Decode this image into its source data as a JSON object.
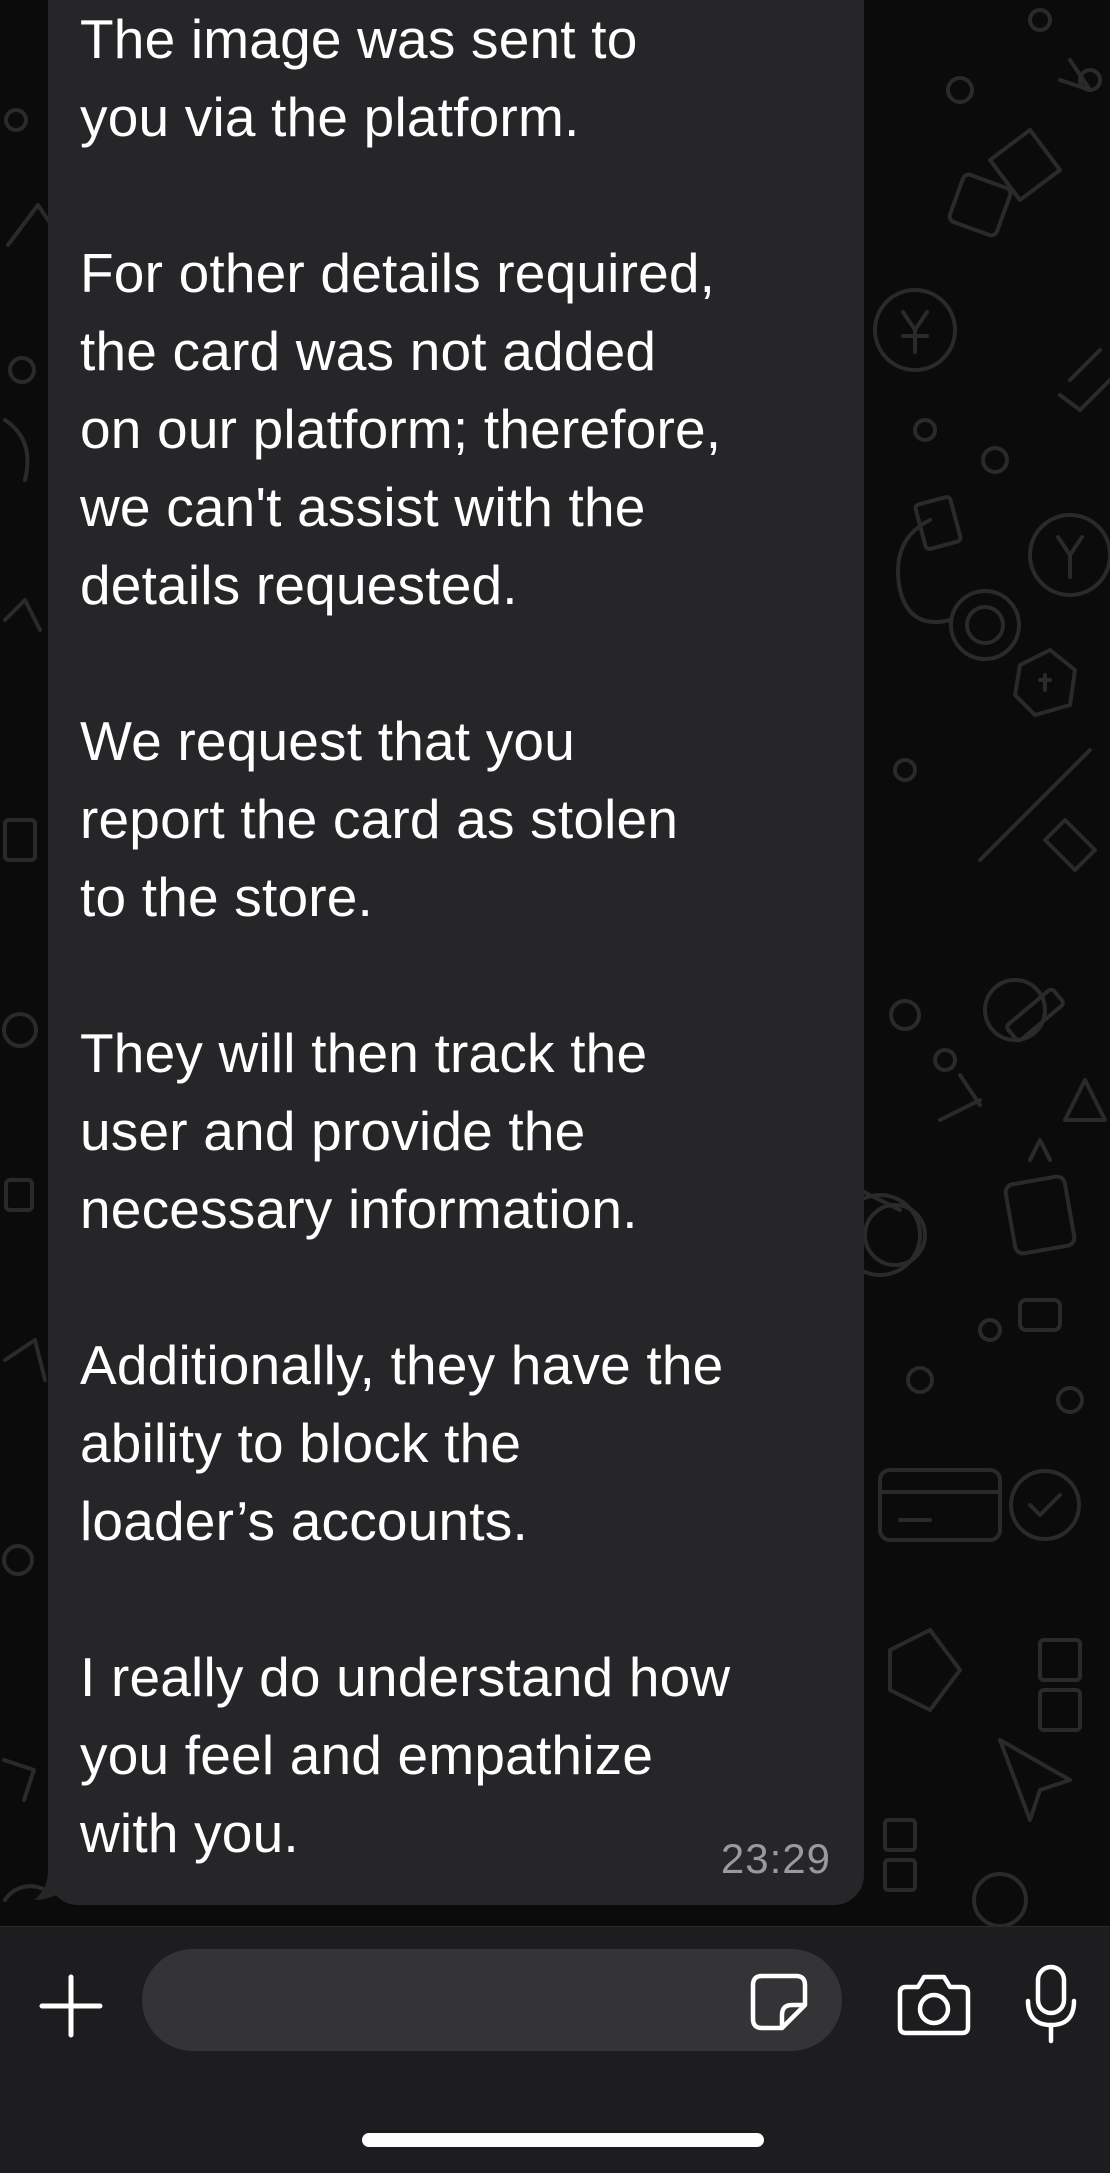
{
  "chat": {
    "message": {
      "text": "The image was sent to\nyou via the platform.\n\nFor other details required,\nthe card was not added\non our platform; therefore,\nwe can't assist with the\ndetails requested.\n\nWe request that you\nreport the card as stolen\nto the store.\n\nThey will then track the\nuser and provide the\nnecessary information.\n\nAdditionally, they have the\nability to block the\nloader’s accounts.\n\nI really do understand how\nyou feel and empathize\nwith you.",
      "time": "23:29"
    }
  },
  "composer": {
    "input_value": "",
    "icons": {
      "attach": "plus-icon",
      "sticker": "sticker-icon",
      "camera": "camera-icon",
      "voice": "microphone-icon"
    }
  },
  "colors": {
    "background": "#0b0b0b",
    "bubble": "#262628",
    "input_bar": "#1d1d1f",
    "input_field": "#343436",
    "timestamp": "#9a9a9e",
    "icon": "#ffffff"
  }
}
